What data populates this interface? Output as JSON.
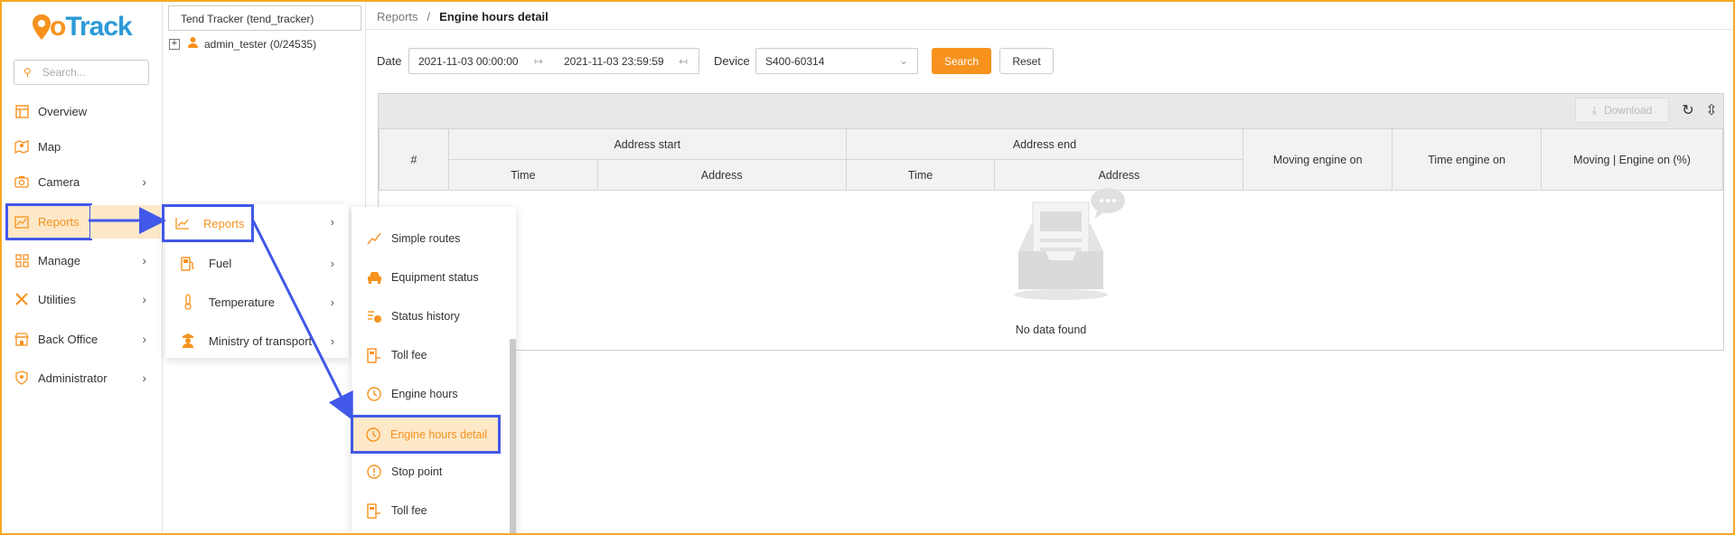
{
  "app": {
    "logo_go": "Go",
    "logo_track": "Track",
    "brand_color": "#f7921e",
    "accent_color": "#2c9ad8",
    "highlight_color": "#4258e8"
  },
  "nav": {
    "search_placeholder": "Search...",
    "items": [
      {
        "label": "Overview",
        "icon": "layout-icon"
      },
      {
        "label": "Map",
        "icon": "map-icon"
      },
      {
        "label": "Camera",
        "icon": "camera-icon"
      },
      {
        "label": "Reports",
        "icon": "chart-icon",
        "active": true
      },
      {
        "label": "Manage",
        "icon": "grid-icon"
      },
      {
        "label": "Utilities",
        "icon": "tools-icon"
      },
      {
        "label": "Back Office",
        "icon": "store-icon"
      },
      {
        "label": "Administrator",
        "icon": "shield-icon"
      }
    ]
  },
  "tree": {
    "selected": "Tend Tracker (tend_tracker)",
    "node_label": "admin_tester (0/24535)"
  },
  "submenu1": {
    "items": [
      {
        "label": "Reports",
        "icon": "line-chart-icon",
        "active": true
      },
      {
        "label": "Fuel",
        "icon": "fuel-icon"
      },
      {
        "label": "Temperature",
        "icon": "thermometer-icon"
      },
      {
        "label": "Ministry of transport",
        "icon": "officer-icon"
      }
    ]
  },
  "submenu2": {
    "items": [
      {
        "label": "Simple routes",
        "icon": "route-icon"
      },
      {
        "label": "Equipment status",
        "icon": "car-icon"
      },
      {
        "label": "Status history",
        "icon": "history-icon"
      },
      {
        "label": "Toll fee",
        "icon": "toll-icon"
      },
      {
        "label": "Engine hours",
        "icon": "clock-icon"
      },
      {
        "label": "Engine hours detail",
        "icon": "clock-icon",
        "active": true
      },
      {
        "label": "Stop point",
        "icon": "alert-icon"
      },
      {
        "label": "Toll fee",
        "icon": "toll-icon"
      }
    ]
  },
  "main": {
    "breadcrumb_parent": "Reports",
    "breadcrumb_sep": "/",
    "breadcrumb_current": "Engine hours detail",
    "date_label": "Date",
    "date_start": "2021-11-03 00:00:00",
    "date_end": "2021-11-03 23:59:59",
    "device_label": "Device",
    "device_value": "S400-60314",
    "search_label": "Search",
    "reset_label": "Reset",
    "download_label": "Download",
    "table": {
      "col_index": "#",
      "group_start": "Address start",
      "group_end": "Address end",
      "col_time": "Time",
      "col_address": "Address",
      "col_moving": "Moving engine on",
      "col_time_on": "Time engine on",
      "col_percent": "Moving | Engine on (%)"
    },
    "empty_text": "No data found"
  }
}
